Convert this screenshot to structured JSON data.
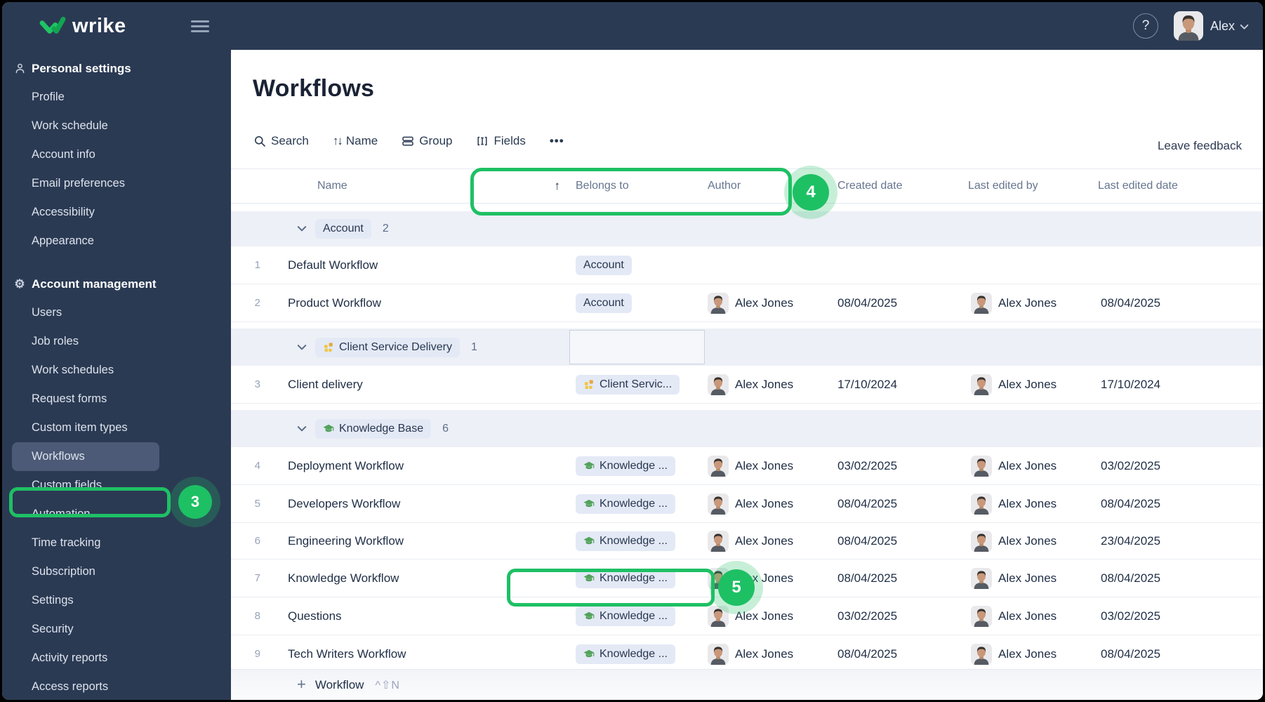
{
  "topbar": {
    "logo": "wrike",
    "help": "?",
    "user": "Alex"
  },
  "sidebar": {
    "sections": [
      {
        "label": "Personal settings",
        "icon": "person-icon",
        "items": [
          "Profile",
          "Work schedule",
          "Account info",
          "Email preferences",
          "Accessibility",
          "Appearance"
        ]
      },
      {
        "label": "Account management",
        "icon": "gear-icon",
        "items": [
          "Users",
          "Job roles",
          "Work schedules",
          "Request forms",
          "Custom item types",
          "Workflows",
          "Custom fields",
          "Automation",
          "Time tracking",
          "Subscription",
          "Settings",
          "Security",
          "Activity reports",
          "Access reports"
        ]
      }
    ],
    "selected_item": "Workflows"
  },
  "main": {
    "title": "Workflows",
    "toolbar": {
      "search": "Search",
      "sort_label": "Name",
      "sort_glyph": "↑↓",
      "group": "Group",
      "fields": "Fields",
      "more": "•••",
      "feedback": "Leave feedback"
    },
    "table": {
      "columns": [
        "Name",
        "Belongs to",
        "Author",
        "Created date",
        "Last edited by",
        "Last edited date"
      ],
      "sort_icon": "↑",
      "groups": [
        {
          "label": "Account",
          "count": "2"
        },
        {
          "label": "Client Service Delivery",
          "count": "1"
        },
        {
          "label": "Knowledge Base",
          "count": "6"
        }
      ],
      "rows": [
        {
          "num": "1",
          "name": "Default Workflow",
          "belongs": "Account",
          "author": "",
          "created": "",
          "edited_by": "",
          "edited": ""
        },
        {
          "num": "2",
          "name": "Product Workflow",
          "belongs": "Account",
          "author": "Alex Jones",
          "created": "08/04/2025",
          "edited_by": "Alex Jones",
          "edited": "08/04/2025"
        },
        {
          "num": "3",
          "name": "Client delivery",
          "belongs": "Client Servic...",
          "author": "Alex Jones",
          "created": "17/10/2024",
          "edited_by": "Alex Jones",
          "edited": "17/10/2024"
        },
        {
          "num": "4",
          "name": "Deployment Workflow",
          "belongs": "Knowledge ...",
          "author": "Alex Jones",
          "created": "03/02/2025",
          "edited_by": "Alex Jones",
          "edited": "03/02/2025"
        },
        {
          "num": "5",
          "name": "Developers Workflow",
          "belongs": "Knowledge ...",
          "author": "Alex Jones",
          "created": "08/04/2025",
          "edited_by": "Alex Jones",
          "edited": "08/04/2025"
        },
        {
          "num": "6",
          "name": "Engineering Workflow",
          "belongs": "Knowledge ...",
          "author": "Alex Jones",
          "created": "08/04/2025",
          "edited_by": "Alex Jones",
          "edited": "23/04/2025"
        },
        {
          "num": "7",
          "name": "Knowledge Workflow",
          "belongs": "Knowledge ...",
          "author": "Alex Jones",
          "created": "08/04/2025",
          "edited_by": "Alex Jones",
          "edited": "08/04/2025"
        },
        {
          "num": "8",
          "name": "Questions",
          "belongs": "Knowledge ...",
          "author": "Alex Jones",
          "created": "03/02/2025",
          "edited_by": "Alex Jones",
          "edited": "03/02/2025"
        },
        {
          "num": "9",
          "name": "Tech Writers Workflow",
          "belongs": "Knowledge ...",
          "author": "Alex Jones",
          "created": "08/04/2025",
          "edited_by": "Alex Jones",
          "edited": "08/04/2025"
        }
      ]
    },
    "add": {
      "plus": "+",
      "label": "Workflow",
      "shortcut": "^⇧N"
    }
  },
  "annotations": {
    "step3": "3",
    "step4": "4",
    "step5": "5"
  },
  "colors": {
    "accent_green": "#1EC064",
    "sidebar_bg": "#2B3A53",
    "selected_item_bg": "#4C5A77",
    "group_row_bg": "#EDF0F6",
    "chip_bg": "#E4E9F6",
    "kb_icon_green": "#53A35C",
    "csd_icon_yellow": "#F0C645"
  }
}
